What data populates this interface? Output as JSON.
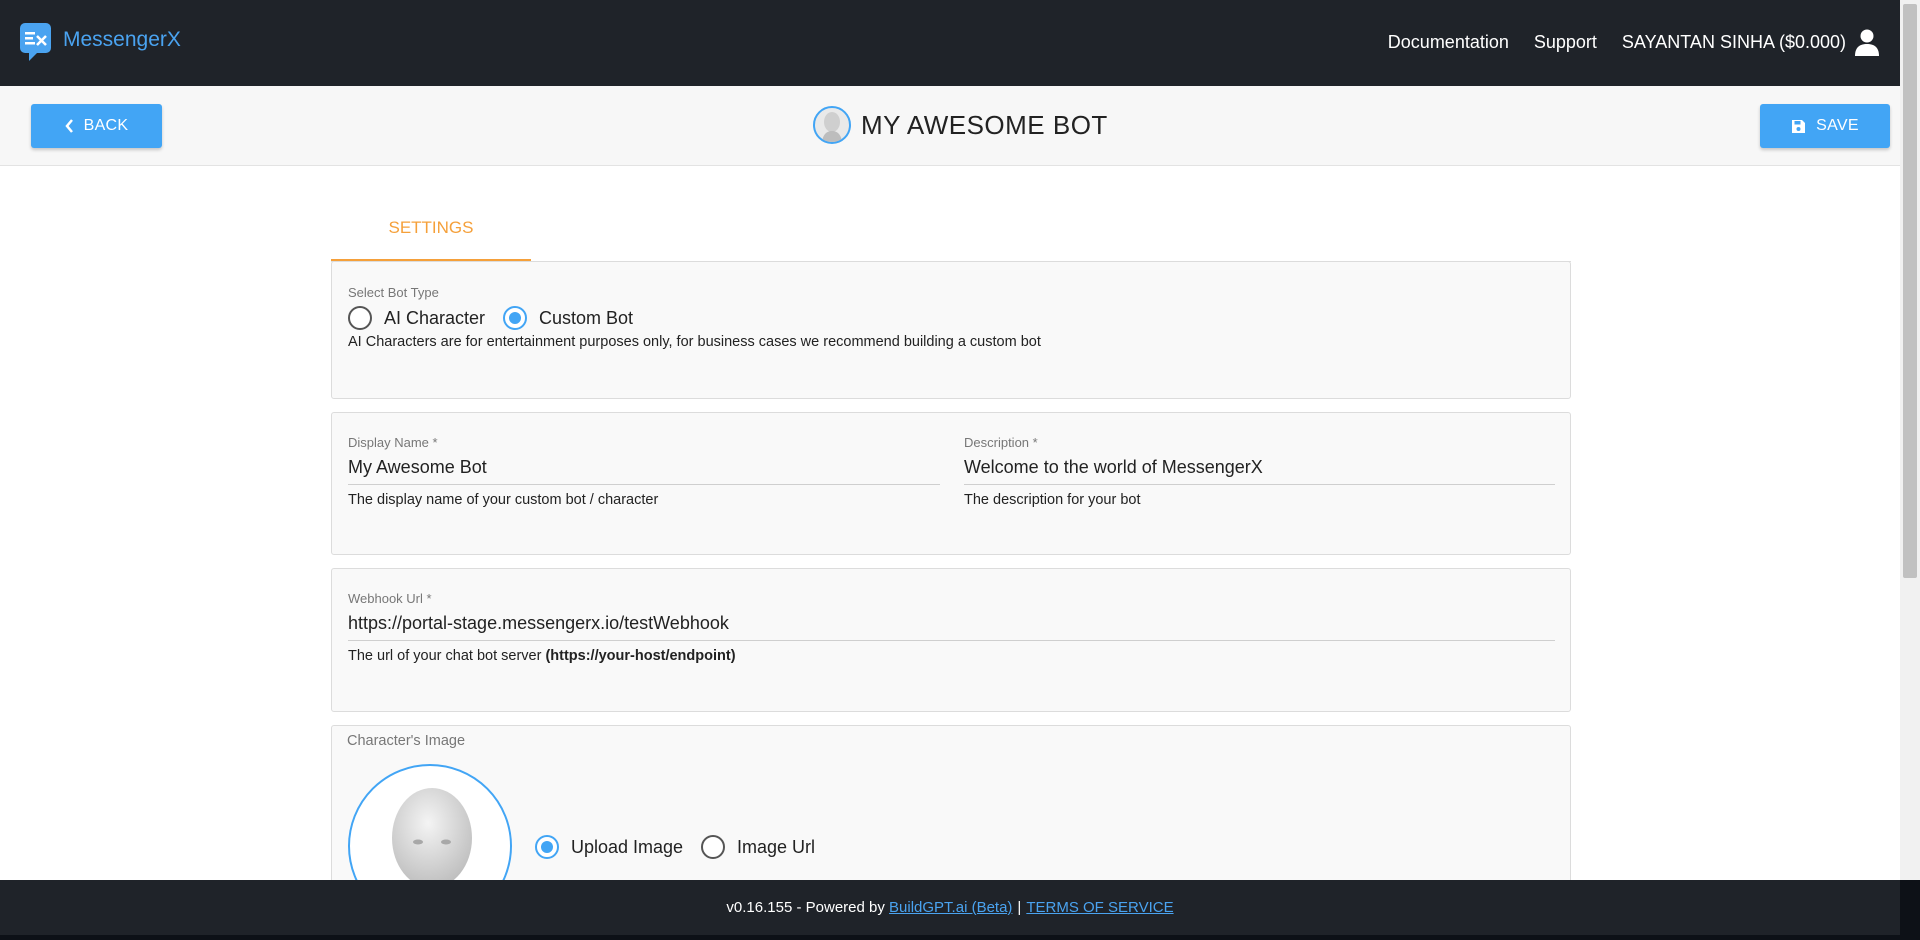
{
  "header": {
    "logo_text": "MessengerX",
    "nav": {
      "documentation": "Documentation",
      "support": "Support",
      "user": "SAYANTAN SINHA ($0.000)"
    }
  },
  "subheader": {
    "back_label": "BACK",
    "title": "MY AWESOME BOT",
    "save_label": "SAVE"
  },
  "tabs": {
    "settings": "SETTINGS"
  },
  "bot_type": {
    "label": "Select Bot Type",
    "options": [
      "AI Character",
      "Custom Bot"
    ],
    "selected": "Custom Bot",
    "helper": "AI Characters are for entertainment purposes only, for business cases we recommend building a custom bot"
  },
  "display_name": {
    "label": "Display Name *",
    "value": "My Awesome Bot",
    "helper": "The display name of your custom bot / character"
  },
  "description": {
    "label": "Description *",
    "value": "Welcome to the world of MessengerX",
    "helper": "The description for your bot"
  },
  "webhook": {
    "label": "Webhook Url *",
    "value": "https://portal-stage.messengerx.io/testWebhook",
    "helper_prefix": "The url of your chat bot server",
    "helper_bold": "(https://your-host/endpoint)"
  },
  "character_image": {
    "label": "Character's Image",
    "options": [
      "Upload Image",
      "Image Url"
    ],
    "selected": "Upload Image"
  },
  "footer": {
    "version": "v0.16.155 - Powered by",
    "powered_link": "BuildGPT.ai (Beta)",
    "separator": "|",
    "tos_link": "TERMS OF SERVICE"
  },
  "colors": {
    "accent": "#42a5f5",
    "tab_active": "#f5a03a",
    "topbar": "#1f2329"
  }
}
